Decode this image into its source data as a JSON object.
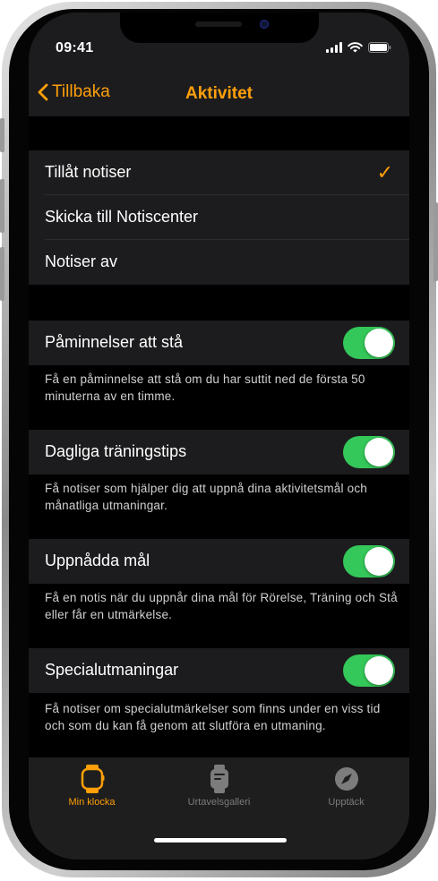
{
  "status": {
    "time": "09:41"
  },
  "nav": {
    "back_label": "Tillbaka",
    "title": "Aktivitet"
  },
  "notice_options": [
    {
      "label": "Tillåt notiser",
      "selected": true
    },
    {
      "label": "Skicka till Notiscenter",
      "selected": false
    },
    {
      "label": "Notiser av",
      "selected": false
    }
  ],
  "settings": [
    {
      "label": "Påminnelser att stå",
      "enabled": true,
      "description": "Få en påminnelse att stå om du har suttit ned de första 50 minuterna av en timme."
    },
    {
      "label": "Dagliga träningstips",
      "enabled": true,
      "description": "Få notiser som hjälper dig att uppnå dina aktivitetsmål och månatliga utmaningar."
    },
    {
      "label": "Uppnådda mål",
      "enabled": true,
      "description": "Få en notis när du uppnår dina mål för Rörelse, Träning och Stå eller får en utmärkelse."
    },
    {
      "label": "Specialutmaningar",
      "enabled": true,
      "description": "Få notiser om specialutmärkelser som finns under en viss tid och som du kan få genom att slutföra en utmaning."
    }
  ],
  "tabs": [
    {
      "label": "Min klocka",
      "icon": "watch-icon",
      "active": true
    },
    {
      "label": "Urtavelsgalleri",
      "icon": "watch-face-icon",
      "active": false
    },
    {
      "label": "Upptäck",
      "icon": "compass-icon",
      "active": false
    }
  ],
  "colors": {
    "accent": "#ff9f0a",
    "toggle_on": "#34c759",
    "background": "#000000",
    "cell": "#1c1c1e"
  }
}
